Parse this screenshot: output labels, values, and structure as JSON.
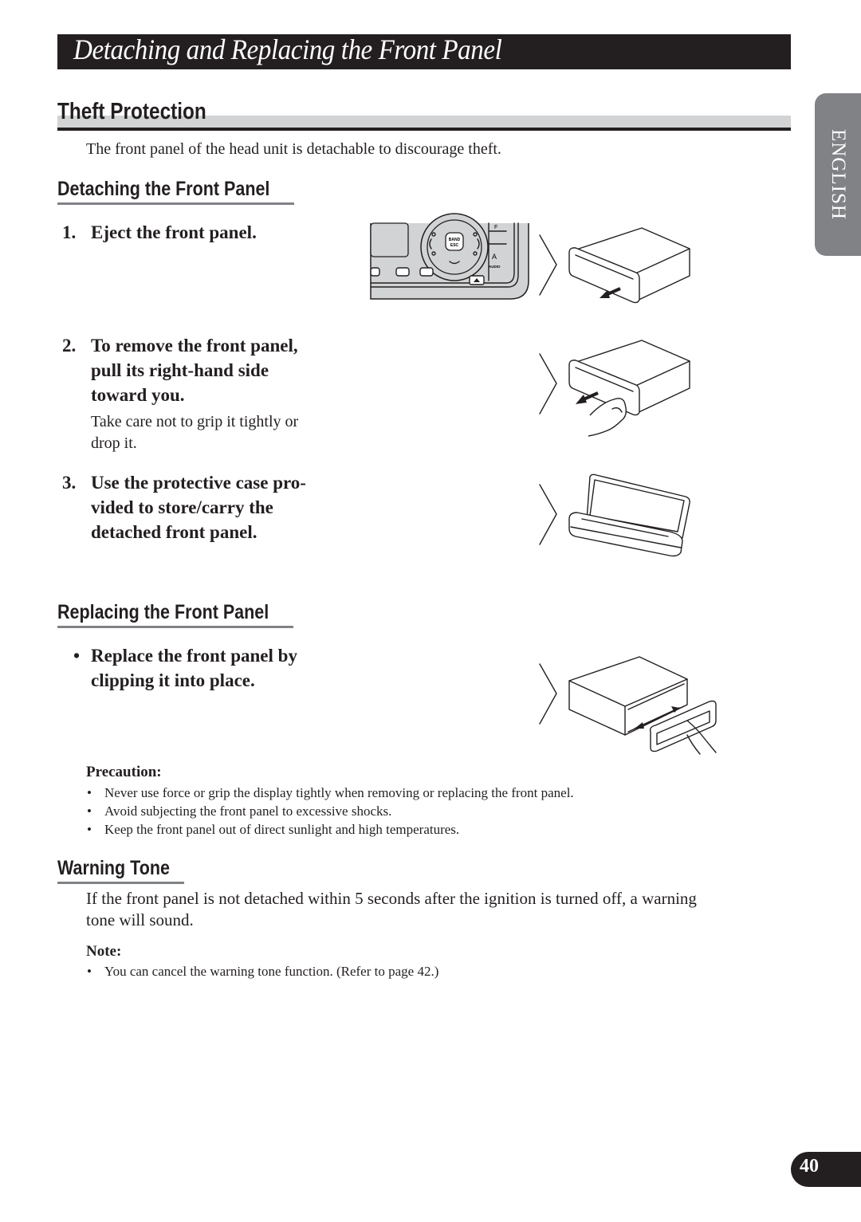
{
  "page": {
    "title": "Detaching and Replacing the Front Panel",
    "language_tab": "ENGLISH",
    "page_number": "40"
  },
  "theft_protection": {
    "heading": "Theft Protection",
    "intro": "The front panel of the head unit is detachable to discourage theft."
  },
  "detaching": {
    "heading": "Detaching the Front Panel",
    "steps": [
      {
        "num": "1.",
        "lines": [
          "Eject the front panel."
        ],
        "note": []
      },
      {
        "num": "2.",
        "lines": [
          "To remove the front panel,",
          "pull its right-hand side",
          "toward you."
        ],
        "note": [
          "Take care not to grip it tightly or",
          "drop it."
        ]
      },
      {
        "num": "3.",
        "lines": [
          "Use the protective case pro-",
          "vided to store/carry the",
          "detached front panel."
        ],
        "note": []
      }
    ]
  },
  "replacing": {
    "heading": "Replacing the Front Panel",
    "bullet": "•",
    "lines": [
      "Replace the front panel by",
      "clipping it into place."
    ]
  },
  "precaution": {
    "heading": "Precaution:",
    "items": [
      "Never use force or grip the display tightly when removing or replacing the front panel.",
      "Avoid subjecting the front panel to excessive shocks.",
      "Keep the front panel out of direct sunlight and high temperatures."
    ]
  },
  "warning_tone": {
    "heading": "Warning Tone",
    "body_lines": [
      "If the front panel is not detached within 5 seconds after the ignition is turned off, a warning",
      "tone will sound."
    ],
    "note_heading": "Note:",
    "notes": [
      "You can cancel the warning tone function. (Refer to page 42.)"
    ]
  },
  "illustration_labels": {
    "band_button": "BAND",
    "esc_button": "ESC",
    "audio_button": "AUDIO",
    "a_button": "A",
    "f_button": "F"
  }
}
